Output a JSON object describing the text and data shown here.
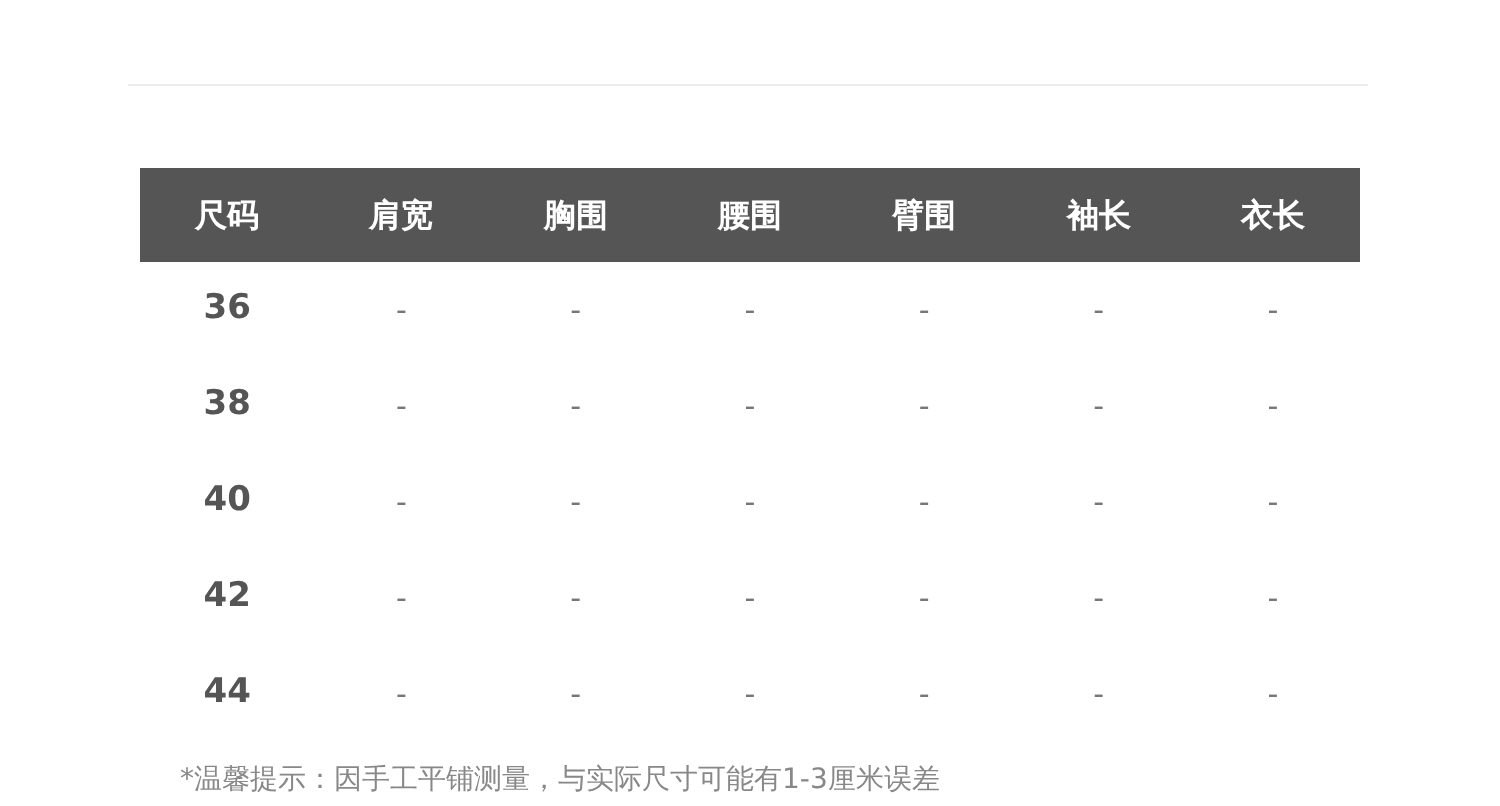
{
  "table": {
    "columns": [
      "尺码",
      "肩宽",
      "胸围",
      "腰围",
      "臂围",
      "袖长",
      "衣长"
    ],
    "rows": [
      [
        "36",
        "-",
        "-",
        "-",
        "-",
        "-",
        "-"
      ],
      [
        "38",
        "-",
        "-",
        "-",
        "-",
        "-",
        "-"
      ],
      [
        "40",
        "-",
        "-",
        "-",
        "-",
        "-",
        "-"
      ],
      [
        "42",
        "-",
        "-",
        "-",
        "-",
        "-",
        "-"
      ],
      [
        "44",
        "-",
        "-",
        "-",
        "-",
        "-",
        "-"
      ]
    ]
  },
  "note": "*温馨提示：因手工平铺测量，与实际尺寸可能有1-3厘米误差"
}
